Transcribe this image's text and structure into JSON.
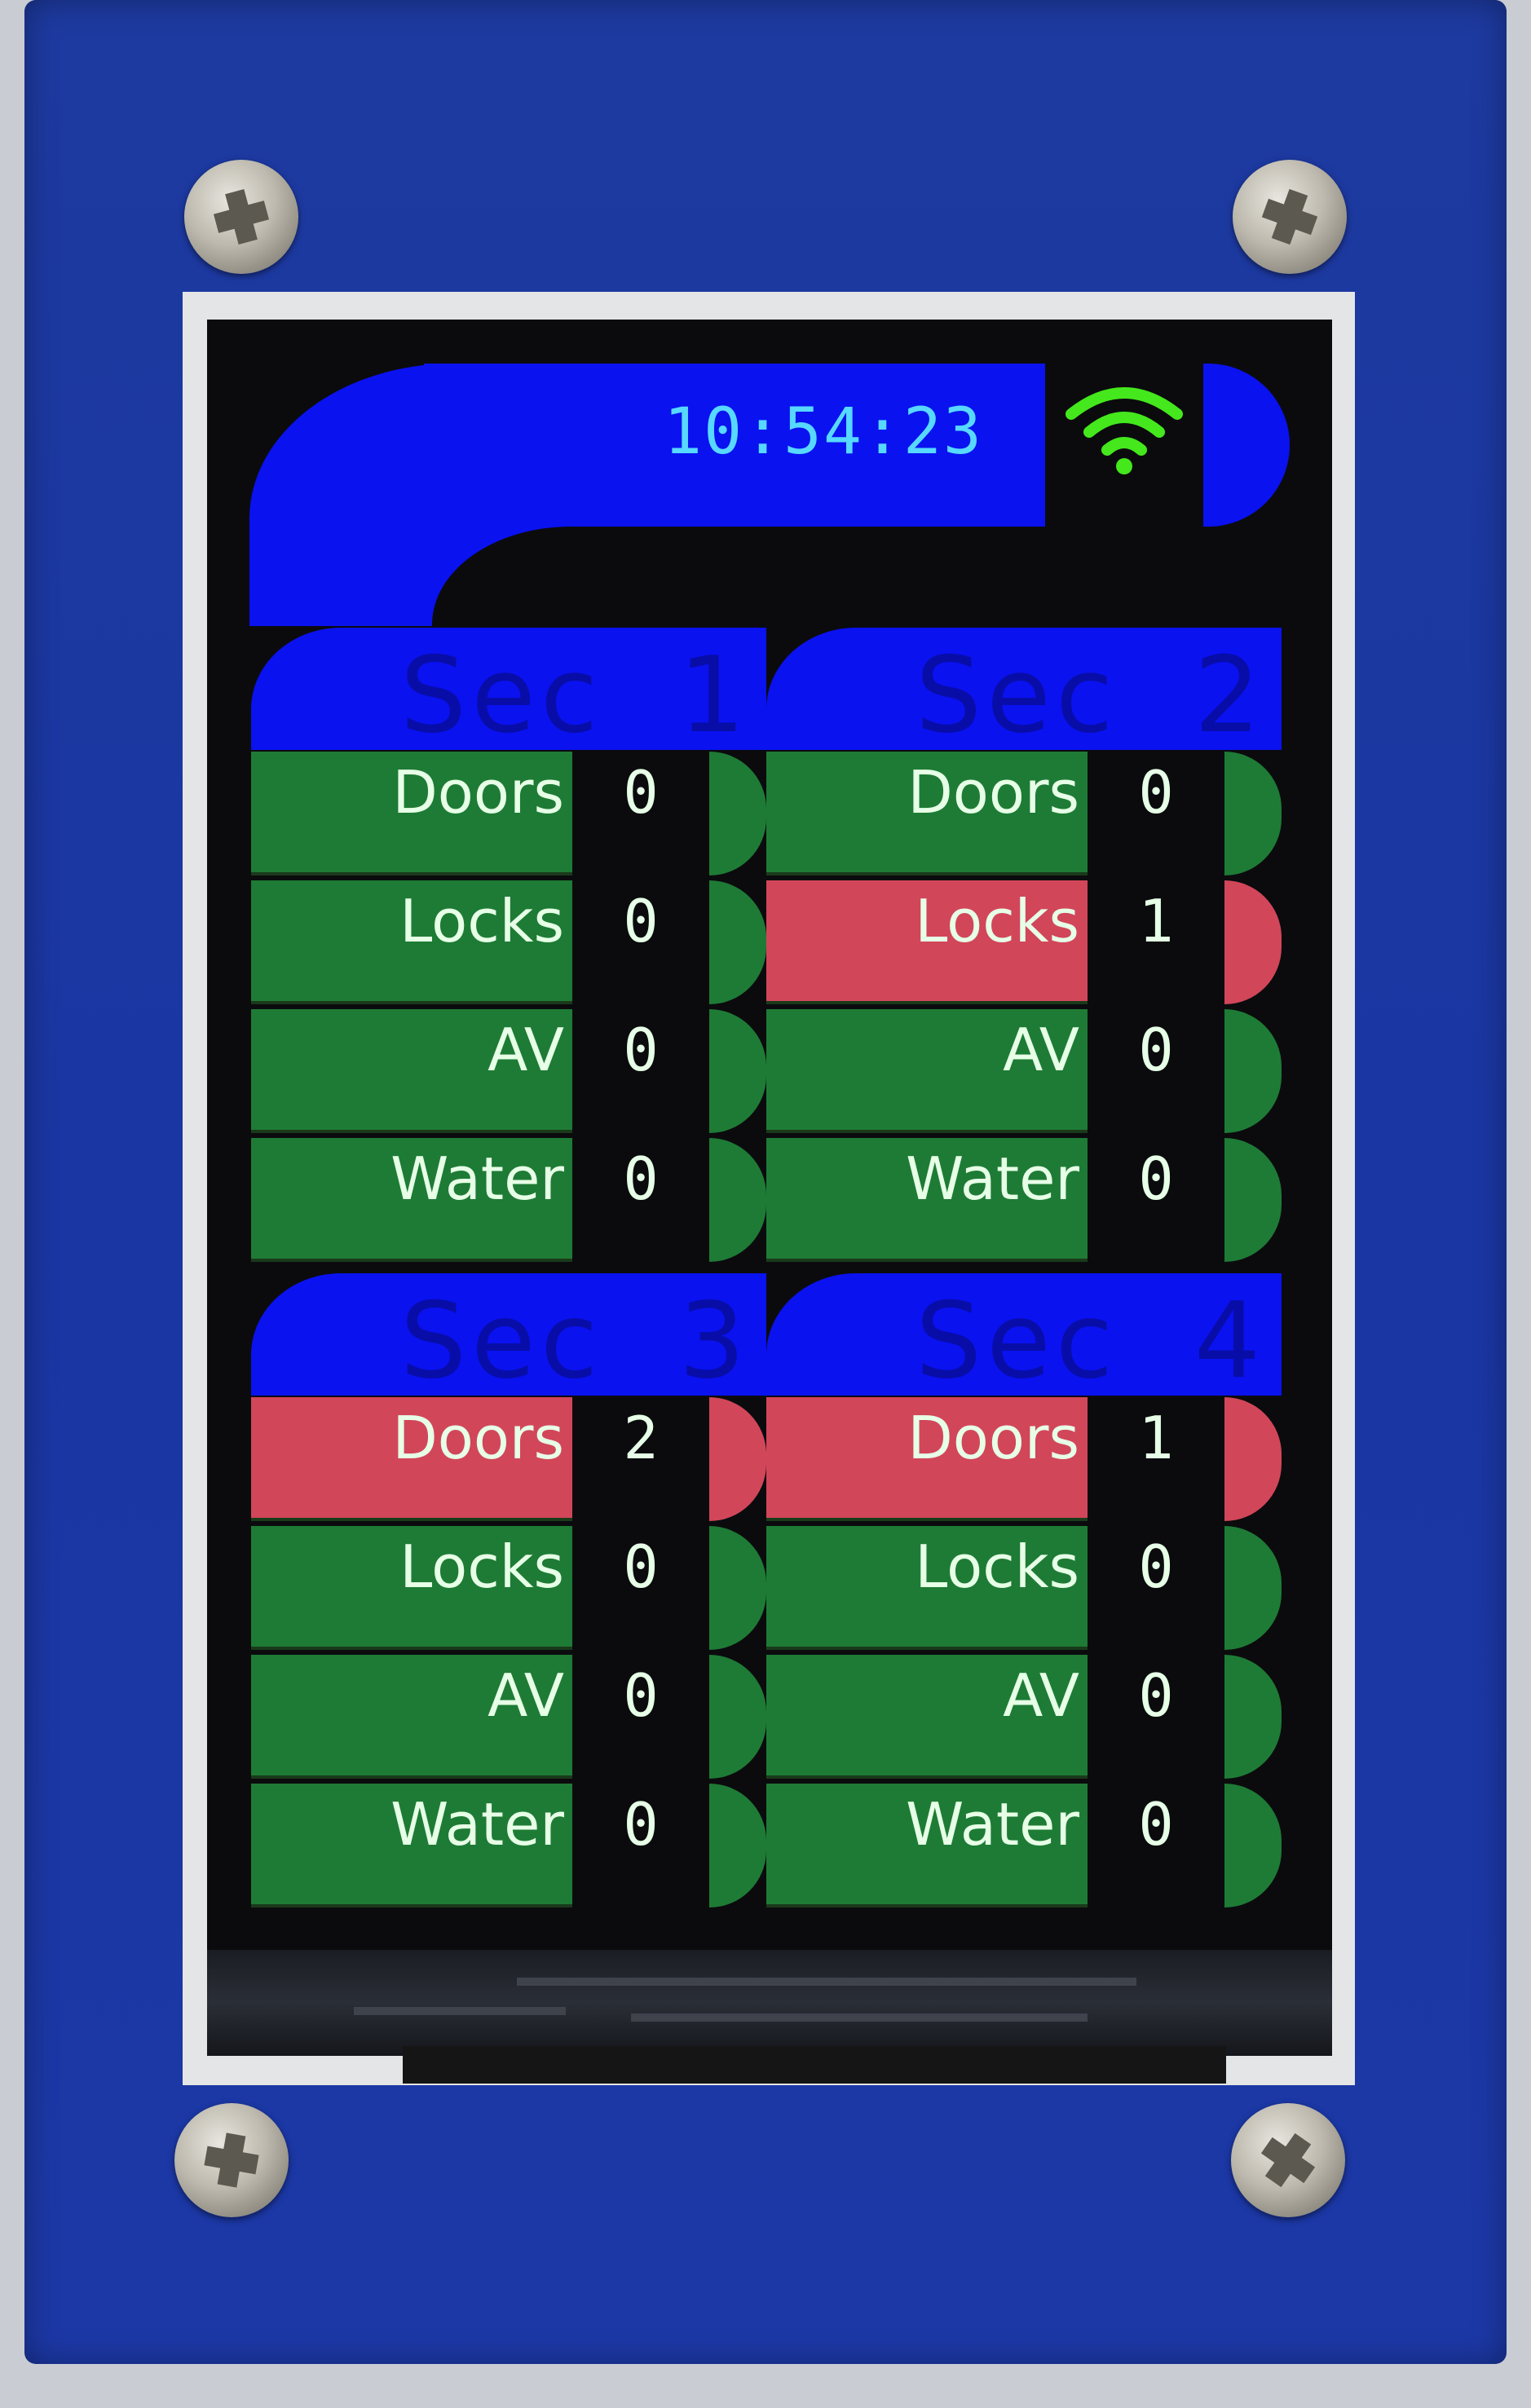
{
  "header": {
    "clock": "10:54:23",
    "wifi_icon": "wifi-icon",
    "colors": {
      "header": "#0a12f0",
      "clock_text": "#57d8ff",
      "wifi": "#44e81c"
    }
  },
  "colors": {
    "ok": "#1e7b35",
    "alert": "#d2465a",
    "section_title": "#080da8",
    "frame": "#1a36a2"
  },
  "sections": [
    {
      "title": "Sec  1",
      "rows": [
        {
          "label": "Doors",
          "count": "0",
          "status": "ok"
        },
        {
          "label": "Locks",
          "count": "0",
          "status": "ok"
        },
        {
          "label": "AV",
          "count": "0",
          "status": "ok"
        },
        {
          "label": "Water",
          "count": "0",
          "status": "ok"
        }
      ]
    },
    {
      "title": "Sec  2",
      "rows": [
        {
          "label": "Doors",
          "count": "0",
          "status": "ok"
        },
        {
          "label": "Locks",
          "count": "1",
          "status": "alert"
        },
        {
          "label": "AV",
          "count": "0",
          "status": "ok"
        },
        {
          "label": "Water",
          "count": "0",
          "status": "ok"
        }
      ]
    },
    {
      "title": "Sec  3",
      "rows": [
        {
          "label": "Doors",
          "count": "2",
          "status": "alert"
        },
        {
          "label": "Locks",
          "count": "0",
          "status": "ok"
        },
        {
          "label": "AV",
          "count": "0",
          "status": "ok"
        },
        {
          "label": "Water",
          "count": "0",
          "status": "ok"
        }
      ]
    },
    {
      "title": "Sec  4",
      "rows": [
        {
          "label": "Doors",
          "count": "1",
          "status": "alert"
        },
        {
          "label": "Locks",
          "count": "0",
          "status": "ok"
        },
        {
          "label": "AV",
          "count": "0",
          "status": "ok"
        },
        {
          "label": "Water",
          "count": "0",
          "status": "ok"
        }
      ]
    }
  ]
}
